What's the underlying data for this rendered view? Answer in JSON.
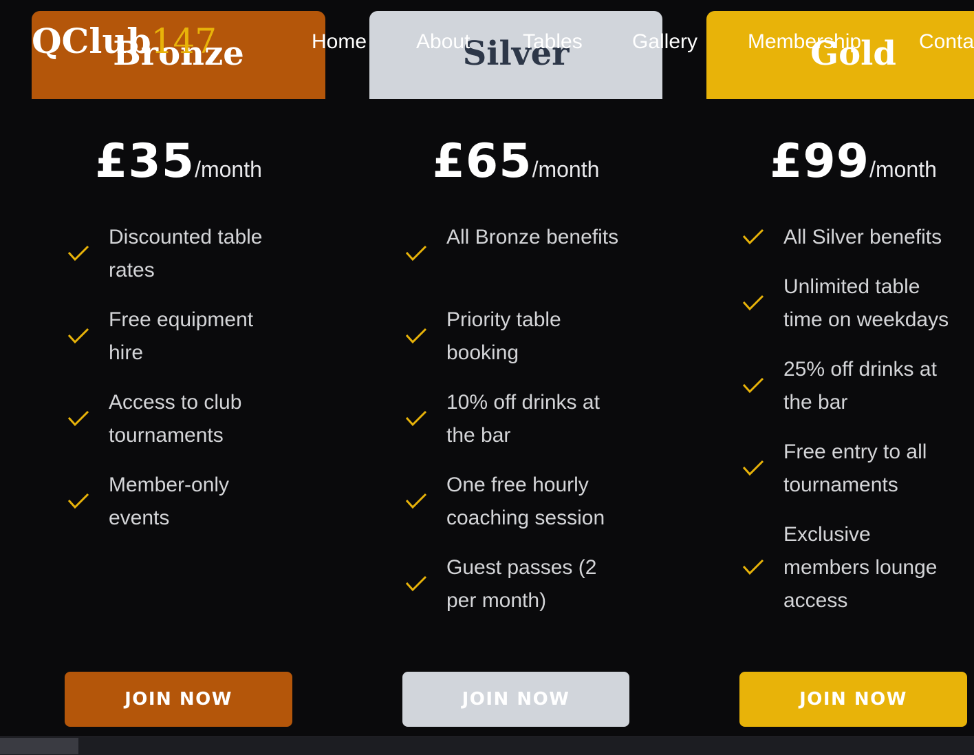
{
  "nav": {
    "logo_main": "QClub",
    "logo_number": "147",
    "links": [
      "Home",
      "About",
      "Tables",
      "Gallery",
      "Membership",
      "Conta"
    ]
  },
  "colors": {
    "accent": "#e8b309",
    "bronze": "#b4560a",
    "silver": "#d1d5db",
    "gold": "#e8b309",
    "background": "#0a0a0c"
  },
  "plans": [
    {
      "name": "Bronze",
      "price": "£35",
      "period": "/month",
      "features": [
        "Discounted table rates",
        "Free equipment hire",
        "Access to club tournaments",
        "Member-only events"
      ],
      "cta": "JOIN NOW"
    },
    {
      "name": "Silver",
      "price": "£65",
      "period": "/month",
      "features": [
        "All Bronze benefits",
        "Priority table booking",
        "10% off drinks at the bar",
        "One free hourly coaching session",
        "Guest passes (2 per month)"
      ],
      "cta": "JOIN NOW"
    },
    {
      "name": "Gold",
      "price": "£99",
      "period": "/month",
      "features": [
        "All Silver benefits",
        "Unlimited table time on weekdays",
        "25% off drinks at the bar",
        "Free entry to all tournaments",
        "Exclusive members lounge access"
      ],
      "cta": "JOIN NOW"
    }
  ],
  "icons": {
    "feature_check": "check-icon"
  }
}
